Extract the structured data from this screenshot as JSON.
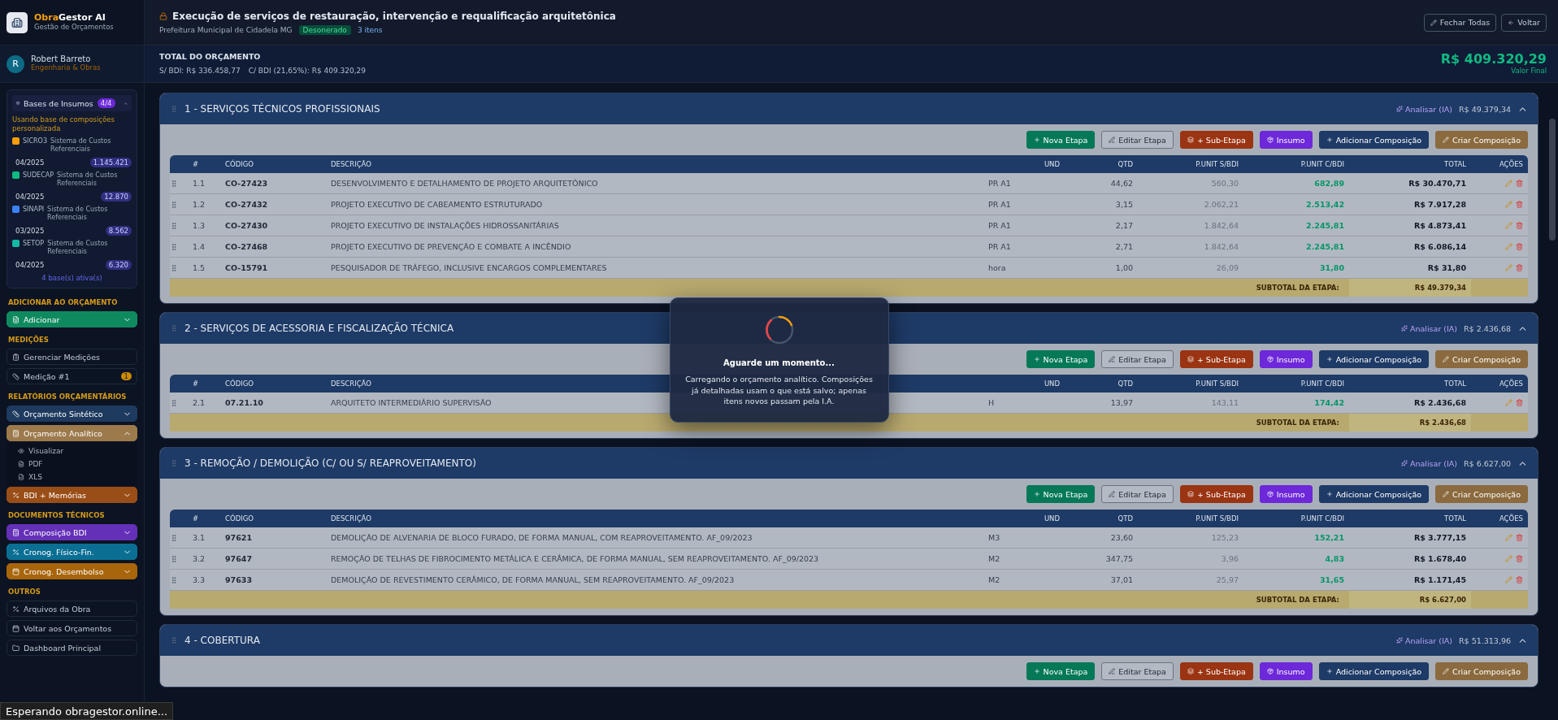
{
  "sidebar": {
    "brand": {
      "prefix": "Obra",
      "suffix": "Gestor AI",
      "subtitle": "Gestão de Orçamentos"
    },
    "user": {
      "initial": "R",
      "name": "Robert Barreto",
      "role": "Engenharia & Obras"
    },
    "bases": {
      "title": "Bases de Insumos",
      "badge": "4/4",
      "expanded": true,
      "note": "Usando base de composições personalizada",
      "items": [
        {
          "name": "SICRO3",
          "description": "Sistema de Custos Referenciais",
          "date": "04/2025",
          "count": "1.145.421",
          "color": "#f59e0b"
        },
        {
          "name": "SUDECAP",
          "description": "Sistema de Custos Referenciais",
          "date": "04/2025",
          "count": "12.870",
          "color": "#10b981"
        },
        {
          "name": "SINAPI",
          "description": "Sistema de Custos Referenciais",
          "date": "03/2025",
          "count": "8.562",
          "color": "#3b82f6"
        },
        {
          "name": "SETOP",
          "description": "Sistema de Custos Referenciais",
          "date": "04/2025",
          "count": "6.320",
          "color": "#14b8a6"
        }
      ],
      "footer": "4 base(s) ativa(s)"
    },
    "groups": [
      {
        "heading": "ADICIONAR AO ORÇAMENTO",
        "items": [
          {
            "label": "Adicionar",
            "color": "#0f8a5f",
            "expanded": false
          }
        ]
      },
      {
        "heading": "MEDIÇÕES",
        "items": [
          {
            "label": "Gerenciar Medições"
          },
          {
            "label": "Medição #1",
            "badge": "1"
          }
        ]
      },
      {
        "heading": "RELATÓRIOS ORÇAMENTÁRIOS",
        "items": [
          {
            "label": "Orçamento Sintético",
            "color": "#1e3a5f",
            "expanded": false
          },
          {
            "label": "Orçamento Analítico",
            "color": "#9c7a4c",
            "expanded": true,
            "children": [
              {
                "label": "Visualizar"
              },
              {
                "label": "PDF"
              },
              {
                "label": "XLS"
              }
            ]
          },
          {
            "label": "BDI + Memórias",
            "color": "#9a4e17",
            "expanded": false
          }
        ]
      },
      {
        "heading": "DOCUMENTOS TÉCNICOS",
        "items": [
          {
            "label": "Composição BDI",
            "color": "#6430b8",
            "expanded": false
          },
          {
            "label": "Cronog. Físico-Fin.",
            "color": "#0b6f94",
            "expanded": false
          },
          {
            "label": "Cronog. Desembolso",
            "color": "#a8650b",
            "expanded": false
          }
        ]
      },
      {
        "heading": "OUTROS",
        "items": [
          {
            "label": "Arquivos da Obra"
          },
          {
            "label": "Voltar aos Orçamentos"
          },
          {
            "label": "Dashboard Principal"
          }
        ]
      }
    ]
  },
  "header": {
    "title": "Execução de serviços de restauração, intervenção e requalificação arquitetônica",
    "client": "Prefeitura Municipal de Cidadela MG",
    "status": "Desonerado",
    "items": "3 itens",
    "buttons": [
      {
        "label": "Fechar Todas",
        "kind": "close-all"
      },
      {
        "label": "Voltar",
        "kind": "back"
      }
    ]
  },
  "total": {
    "label": "TOTAL DO ORÇAMENTO",
    "without_bdi": "S/ BDI: R$ 336.458,77",
    "with_bdi": "C/ BDI (21,65%): R$ 409.320,29",
    "amount": "R$ 409.320,29",
    "caption": "Valor Final"
  },
  "sections": [
    {
      "title": "1 - SERVIÇOS TÉCNICOS PROFISSIONAIS",
      "ai_label": "Analisar (IA)",
      "total": "R$ 49.379,34",
      "expanded": true,
      "toolbar": [
        {
          "label": "Nova Etapa",
          "kind": "new"
        },
        {
          "label": "Editar Etapa",
          "kind": "edit"
        },
        {
          "label": "+ Sub-Etapa",
          "kind": "sub"
        },
        {
          "label": "Insumo",
          "kind": "insumo"
        },
        {
          "label": "Adicionar Composição",
          "kind": "add"
        },
        {
          "label": "Criar Composição",
          "kind": "create"
        }
      ],
      "columns": [
        "#",
        "CÓDIGO",
        "DESCRIÇÃO",
        "UND",
        "QTD",
        "P.UNIT S/BDI",
        "P.UNIT C/BDI",
        "TOTAL",
        "AÇÕES"
      ],
      "rows": [
        {
          "num": "1.1",
          "code": "CO-27423",
          "description": "DESENVOLVIMENTO E DETALHAMENTO DE PROJETO ARQUITETÔNICO",
          "unit": "PR A1",
          "qty": "44,62",
          "price": "560,30",
          "price_bdi": "682,89",
          "total": "R$ 30.470,71"
        },
        {
          "num": "1.2",
          "code": "CO-27432",
          "description": "PROJETO EXECUTIVO DE CABEAMENTO ESTRUTURADO",
          "unit": "PR A1",
          "qty": "3,15",
          "price": "2.062,21",
          "price_bdi": "2.513,42",
          "total": "R$ 7.917,28"
        },
        {
          "num": "1.3",
          "code": "CO-27430",
          "description": "PROJETO EXECUTIVO DE INSTALAÇÕES HIDROSSANITÁRIAS",
          "unit": "PR A1",
          "qty": "2,17",
          "price": "1.842,64",
          "price_bdi": "2.245,81",
          "total": "R$ 4.873,41"
        },
        {
          "num": "1.4",
          "code": "CO-27468",
          "description": "PROJETO EXECUTIVO DE PREVENÇÃO E COMBATE A INCÊNDIO",
          "unit": "PR A1",
          "qty": "2,71",
          "price": "1.842,64",
          "price_bdi": "2.245,81",
          "total": "R$ 6.086,14"
        },
        {
          "num": "1.5",
          "code": "CO-15791",
          "description": "PESQUISADOR DE TRÁFEGO, INCLUSIVE ENCARGOS COMPLEMENTARES",
          "unit": "hora",
          "qty": "1,00",
          "price": "26,09",
          "price_bdi": "31,80",
          "total": "R$ 31,80"
        }
      ],
      "subtotal_label": "SUBTOTAL DA ETAPA:",
      "subtotal": "R$ 49.379,34"
    },
    {
      "title": "2 - SERVIÇOS DE ACESSORIA E FISCALIZAÇÃO TÉCNICA",
      "ai_label": "Analisar (IA)",
      "total": "R$ 2.436,68",
      "expanded": true,
      "toolbar": [
        {
          "label": "Nova Etapa",
          "kind": "new"
        },
        {
          "label": "Editar Etapa",
          "kind": "edit"
        },
        {
          "label": "+ Sub-Etapa",
          "kind": "sub"
        },
        {
          "label": "Insumo",
          "kind": "insumo"
        },
        {
          "label": "Adicionar Composição",
          "kind": "add"
        },
        {
          "label": "Criar Composição",
          "kind": "create"
        }
      ],
      "columns": [
        "#",
        "CÓDIGO",
        "DESCRIÇÃO",
        "UND",
        "QTD",
        "P.UNIT S/BDI",
        "P.UNIT C/BDI",
        "TOTAL",
        "AÇÕES"
      ],
      "rows": [
        {
          "num": "2.1",
          "code": "07.21.10",
          "description": "ARQUITETO INTERMEDIÁRIO SUPERVISÃO",
          "unit": "H",
          "qty": "13,97",
          "price": "143,11",
          "price_bdi": "174,42",
          "total": "R$ 2.436,68"
        }
      ],
      "subtotal_label": "SUBTOTAL DA ETAPA:",
      "subtotal": "R$ 2.436,68"
    },
    {
      "title": "3 - REMOÇÃO / DEMOLIÇÃO (C/ OU S/ REAPROVEITAMENTO)",
      "ai_label": "Analisar (IA)",
      "total": "R$ 6.627,00",
      "expanded": true,
      "toolbar": [
        {
          "label": "Nova Etapa",
          "kind": "new"
        },
        {
          "label": "Editar Etapa",
          "kind": "edit"
        },
        {
          "label": "+ Sub-Etapa",
          "kind": "sub"
        },
        {
          "label": "Insumo",
          "kind": "insumo"
        },
        {
          "label": "Adicionar Composição",
          "kind": "add"
        },
        {
          "label": "Criar Composição",
          "kind": "create"
        }
      ],
      "columns": [
        "#",
        "CÓDIGO",
        "DESCRIÇÃO",
        "UND",
        "QTD",
        "P.UNIT S/BDI",
        "P.UNIT C/BDI",
        "TOTAL",
        "AÇÕES"
      ],
      "rows": [
        {
          "num": "3.1",
          "code": "97621",
          "description": "DEMOLIÇÃO DE ALVENARIA DE BLOCO FURADO, DE FORMA MANUAL, COM REAPROVEITAMENTO. AF_09/2023",
          "unit": "M3",
          "qty": "23,60",
          "price": "125,23",
          "price_bdi": "152,21",
          "total": "R$ 3.777,15"
        },
        {
          "num": "3.2",
          "code": "97647",
          "description": "REMOÇÃO DE TELHAS DE FIBROCIMENTO METÁLICA E CERÂMICA, DE FORMA MANUAL, SEM REAPROVEITAMENTO. AF_09/2023",
          "unit": "M2",
          "qty": "347,75",
          "price": "3,96",
          "price_bdi": "4,83",
          "total": "R$ 1.678,40"
        },
        {
          "num": "3.3",
          "code": "97633",
          "description": "DEMOLIÇÃO DE REVESTIMENTO CERÂMICO, DE FORMA MANUAL, SEM REAPROVEITAMENTO. AF_09/2023",
          "unit": "M2",
          "qty": "37,01",
          "price": "25,97",
          "price_bdi": "31,65",
          "total": "R$ 1.171,45"
        }
      ],
      "subtotal_label": "SUBTOTAL DA ETAPA:",
      "subtotal": "R$ 6.627,00"
    },
    {
      "title": "4 - COBERTURA",
      "ai_label": "Analisar (IA)",
      "total": "R$ 51.313,96",
      "expanded": true,
      "toolbar": [
        {
          "label": "Nova Etapa",
          "kind": "new"
        },
        {
          "label": "Editar Etapa",
          "kind": "edit"
        },
        {
          "label": "+ Sub-Etapa",
          "kind": "sub"
        },
        {
          "label": "Insumo",
          "kind": "insumo"
        },
        {
          "label": "Adicionar Composição",
          "kind": "add"
        },
        {
          "label": "Criar Composição",
          "kind": "create"
        }
      ]
    }
  ],
  "modal": {
    "title": "Aguarde um momento...",
    "message": "Carregando o orçamento analítico. Composições já detalhadas usam o que está salvo; apenas itens novos passam pela I.A."
  },
  "status_bar": "Esperando obragestor.online..."
}
